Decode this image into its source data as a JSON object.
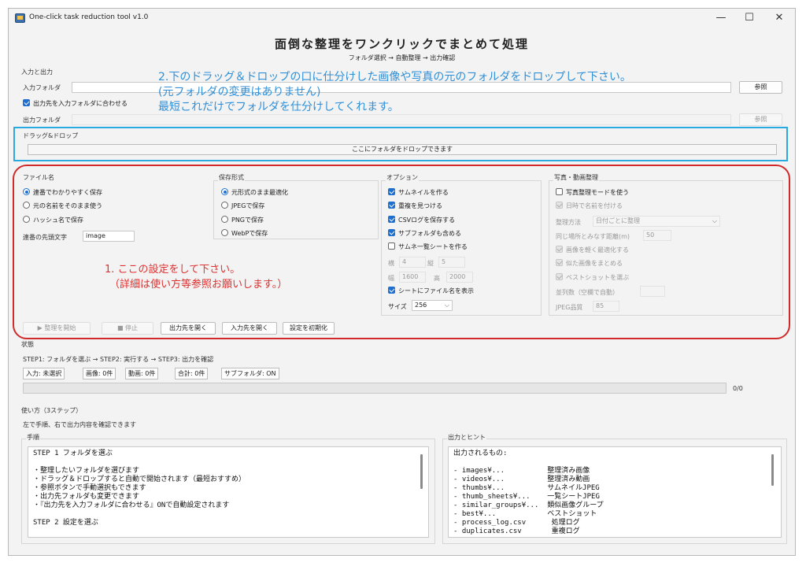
{
  "window": {
    "title": "One-click task reduction tool v1.0",
    "controls": [
      "—",
      "☐",
      "✕"
    ]
  },
  "header": {
    "title": "面倒な整理をワンクリックでまとめて処理",
    "subtitle": "フォルダ選択 → 自動整理 → 出力確認"
  },
  "io": {
    "group_label": "入力と出力",
    "input_label": "入力フォルダ",
    "input_value": "",
    "browse_label": "参照",
    "sync_label": "出力先を入力フォルダに合わせる",
    "output_label": "出力フォルダ",
    "output_value": "",
    "output_browse_label": "参照"
  },
  "drop": {
    "group_label": "ドラッグ&ドロップ",
    "hint": "ここにフォルダをドロップできます"
  },
  "annotations": {
    "blue_line1": "2.下のドラッグ＆ドロップの口に仕分けした画像や写真の元のフォルダをドロップして下さい。",
    "blue_line2": "(元フォルダの変更はありません)",
    "blue_line3": "最短これだけでフォルダを仕分けしてくれます。",
    "red_line1": "1. ここの設定をして下さい。",
    "red_line2": "（詳細は使い方等参照お願いします。）"
  },
  "filename": {
    "label": "ファイル名",
    "options": [
      "連番でわかりやすく保存",
      "元の名前をそのまま使う",
      "ハッシュ名で保存"
    ],
    "selected": 0,
    "prefix_label": "連番の先頭文字",
    "prefix_value": "image"
  },
  "format": {
    "label": "保存形式",
    "options": [
      "元形式のまま最適化",
      "JPEGで保存",
      "PNGで保存",
      "WebPで保存"
    ],
    "selected": 0
  },
  "options": {
    "label": "オプション",
    "checks": [
      {
        "label": "サムネイルを作る",
        "checked": true
      },
      {
        "label": "重複を見つける",
        "checked": true
      },
      {
        "label": "CSVログを保存する",
        "checked": true
      },
      {
        "label": "サブフォルダも含める",
        "checked": true
      },
      {
        "label": "サムネ一覧シートを作る",
        "checked": false
      }
    ],
    "cols_label": "横",
    "cols_value": "4",
    "rows_label": "縦",
    "rows_value": "5",
    "width_label": "幅",
    "width_value": "1600",
    "height_label": "高",
    "height_value": "2000",
    "filename_on_sheet": {
      "label": "シートにファイル名を表示",
      "checked": true
    },
    "size_label": "サイズ",
    "size_value": "256"
  },
  "photo": {
    "label": "写真・動画整理",
    "mode_label": "写真整理モードを使う",
    "date_name_label": "日時で名前を付ける",
    "method_label": "整理方法",
    "method_value": "日付ごとに整理",
    "distance_label": "同じ場所とみなす距離(m)",
    "distance_value": "50",
    "lighten_label": "画像を軽く最適化する",
    "similar_label": "似た画像をまとめる",
    "best_label": "ベストショットを選ぶ",
    "parallel_label": "並列数（空欄で自動）",
    "parallel_value": "",
    "jpeg_label": "JPEG品質",
    "jpeg_value": "85"
  },
  "actions": {
    "start": "▶ 整理を開始",
    "stop": "■ 停止",
    "open_output": "出力先を開く",
    "open_input": "入力先を開く",
    "reset": "設定を初期化"
  },
  "status": {
    "label": "状態",
    "steps": "STEP1: フォルダを選ぶ → STEP2: 実行する → STEP3: 出力を確認",
    "tags": [
      "入力: 未選択",
      "画像: 0件",
      "動画: 0件",
      "合計: 0件",
      "サブフォルダ: ON"
    ],
    "progress_text": "0/0",
    "progress": 0
  },
  "usage": {
    "label": "使い方（3ステップ）",
    "desc": "左で手順、右で出力内容を確認できます",
    "procedure_label": "手順",
    "procedure_text": "STEP 1 フォルダを選ぶ\n\n・整理したいフォルダを選びます\n・ドラッグ＆ドロップすると自動で開始されます（最短おすすめ）\n・参照ボタンで手動選択もできます\n・出力先フォルダも変更できます\n・『出力先を入力フォルダに合わせる』ONで自動設定されます\n\nSTEP 2 設定を選ぶ",
    "hints_label": "出力とヒント",
    "hints_text": "出力されるもの:\n\n- images¥...          整理済み画像\n- videos¥...          整理済み動画\n- thumbs¥...          サムネイルJPEG\n- thumb_sheets¥...    一覧シートJPEG\n- similar_groups¥...  類似画像グループ\n- best¥...            ベストショット\n- process_log.csv      処理ログ\n- duplicates.csv       重複ログ"
  },
  "colors": {
    "annotation_blue": "#2f8fd8",
    "annotation_red": "#e03030",
    "drop_box": "#29a9e0",
    "check_blue": "#1f6fcf"
  }
}
